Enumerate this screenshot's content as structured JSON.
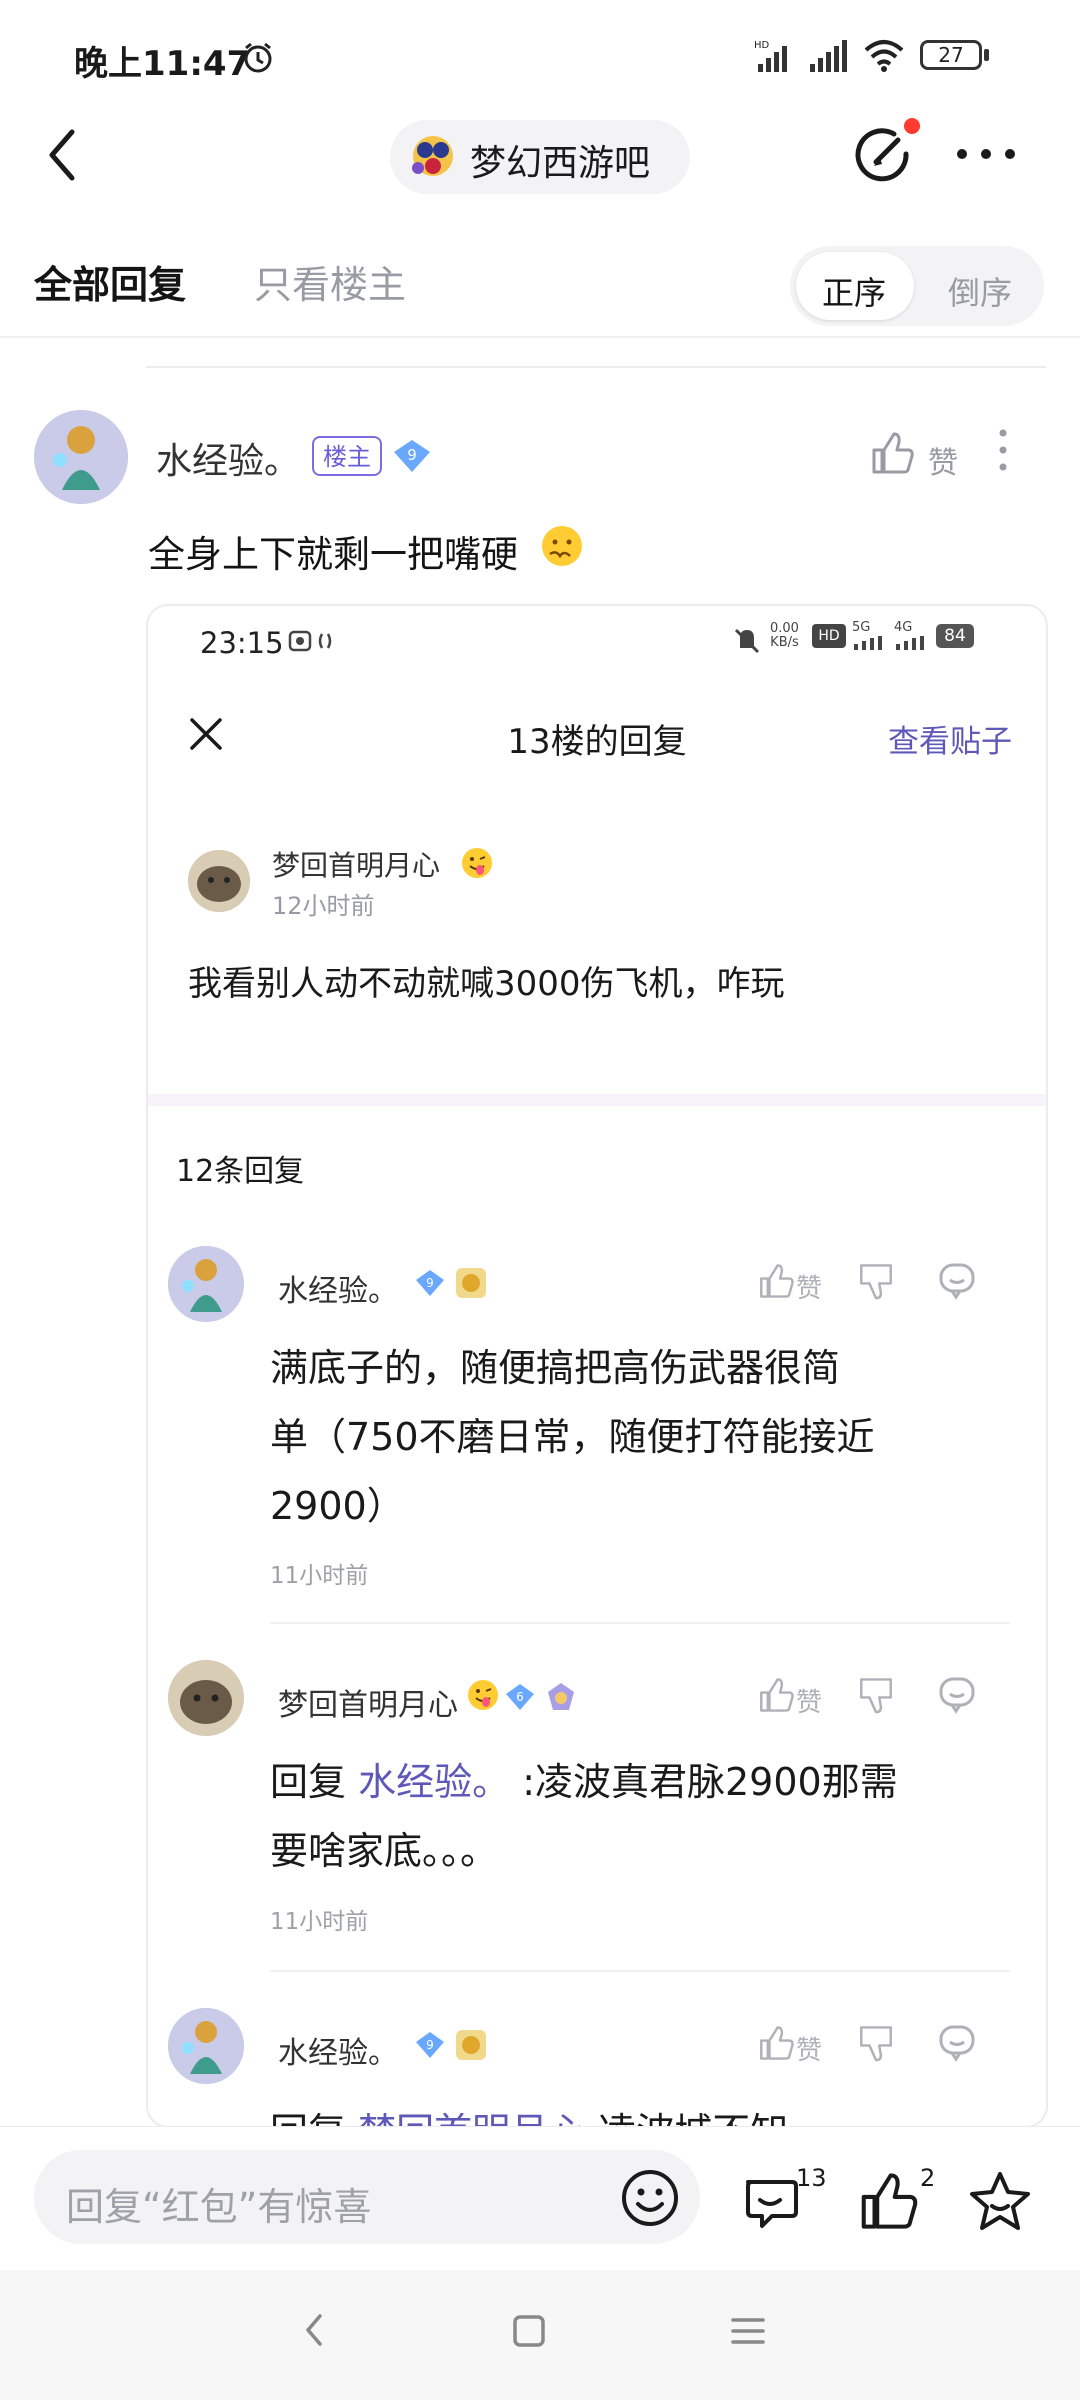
{
  "status_bar": {
    "time": "晚上11:47",
    "battery": "27"
  },
  "header": {
    "forum_name": "梦幻西游吧"
  },
  "tabs": {
    "all_replies": "全部回复",
    "only_host": "只看楼主",
    "order_asc": "正序",
    "order_desc": "倒序"
  },
  "post": {
    "author": "水经验。",
    "host_badge": "楼主",
    "level": "9",
    "like_label": "赞",
    "text": "全身上下就剩一把嘴硬",
    "embedded": {
      "status_time": "23:15",
      "net_speed": "0.00",
      "net_unit": "KB/s",
      "signal1": "5G",
      "signal2": "4G",
      "battery": "84",
      "title": "13楼的回复",
      "view_post": "查看贴子",
      "floor_author": "梦回首明月心",
      "floor_time": "12小时前",
      "floor_content": "我看别人动不动就喊3000伤飞机，咋玩",
      "reply_count": "12条回复",
      "replies": [
        {
          "author": "水经验。",
          "level": "9",
          "like": "赞",
          "text_lines": [
            "满底子的，随便搞把高伤武器很简",
            "单（750不磨日常，随便打符能接近",
            "2900）"
          ],
          "time": "11小时前"
        },
        {
          "author": "梦回首明月心",
          "level": "6",
          "like": "赞",
          "prefix": "回复",
          "mention": "水经验。",
          "text_first": " :凌波真君脉2900那需",
          "text_second": "要啥家底。。。",
          "time": "11小时前"
        },
        {
          "author": "水经验。",
          "level": "9",
          "like": "赞",
          "prefix": "回复",
          "mention": "梦回首明月心",
          "partial": "凌波城不知"
        }
      ]
    }
  },
  "bottom": {
    "reply_placeholder": "回复“红包”有惊喜",
    "comment_count": "13",
    "like_count": "2"
  },
  "colors": {
    "accent": "#5e58b8",
    "notify_dot": "#ff3b30",
    "level_badge": "#6aa8ff"
  }
}
